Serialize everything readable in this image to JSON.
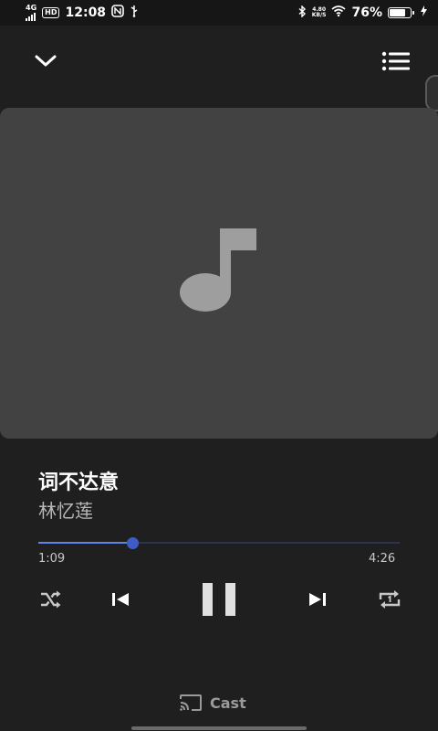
{
  "status_bar": {
    "network": "4G",
    "hd": "HD",
    "time": "12:08",
    "speed_value": "4.80",
    "speed_unit": "KB/S",
    "battery_percent": "76%",
    "battery_level": 0.76,
    "icons": [
      "signal-icon",
      "nfc-icon",
      "usb-icon",
      "bluetooth-icon",
      "wifi-icon",
      "battery-icon",
      "charging-icon"
    ]
  },
  "header": {
    "collapse_icon": "chevron-down-icon",
    "queue_icon": "queue-list-icon"
  },
  "album_art": {
    "placeholder_icon": "music-note-icon",
    "background": "#424242",
    "icon_color": "#9e9e9e"
  },
  "track": {
    "title": "词不达意",
    "artist": "林忆莲"
  },
  "progress": {
    "current": "1:09",
    "total": "4:26",
    "fraction": 0.259,
    "played_color": "#5c84e0",
    "thumb_color": "#3f5cc6"
  },
  "controls": {
    "shuffle_icon": "shuffle-icon",
    "previous_icon": "skip-previous-icon",
    "pause_icon": "pause-icon",
    "next_icon": "skip-next-icon",
    "repeat_icon": "repeat-one-icon"
  },
  "cast": {
    "label": "Cast",
    "icon": "cast-icon"
  }
}
